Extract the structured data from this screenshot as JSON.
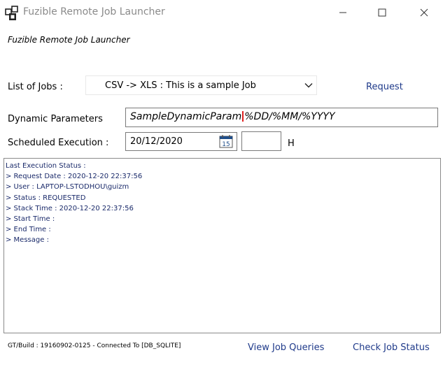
{
  "window": {
    "title": "Fuzible Remote Job Launcher",
    "subtitle": "Fuzible Remote Job Launcher"
  },
  "jobs": {
    "label": "List of Jobs :",
    "selected": "CSV -> XLS : This is a sample Job",
    "request_label": "Request"
  },
  "dynamic": {
    "label": "Dynamic Parameters",
    "value_part1": "SampleDynamicParam",
    "value_part2": "%DD/%MM/%YYYY"
  },
  "schedule": {
    "label": "Scheduled Execution :",
    "date": "20/12/2020",
    "calendar_day": "15",
    "hour_value": "",
    "hour_unit": "H"
  },
  "status": {
    "lines": [
      "Last Execution Status :",
      "> Request Date : 2020-12-20 22:37:56",
      "> User : LAPTOP-LSTODHOU\\guizm",
      "> Status : REQUESTED",
      "> Stack Time : 2020-12-20 22:37:56",
      "> Start Time :",
      "> End Time :",
      "> Message :"
    ]
  },
  "footer": {
    "build": "GT/Build : 19160902-0125 - Connected To [DB_SQLITE]",
    "view_queries": "View Job Queries",
    "check_status": "Check Job Status"
  },
  "colors": {
    "link": "#1f3a8a",
    "status_text": "#1a2a6a",
    "caret": "#e02020",
    "calendar": "#1f4e8a"
  }
}
